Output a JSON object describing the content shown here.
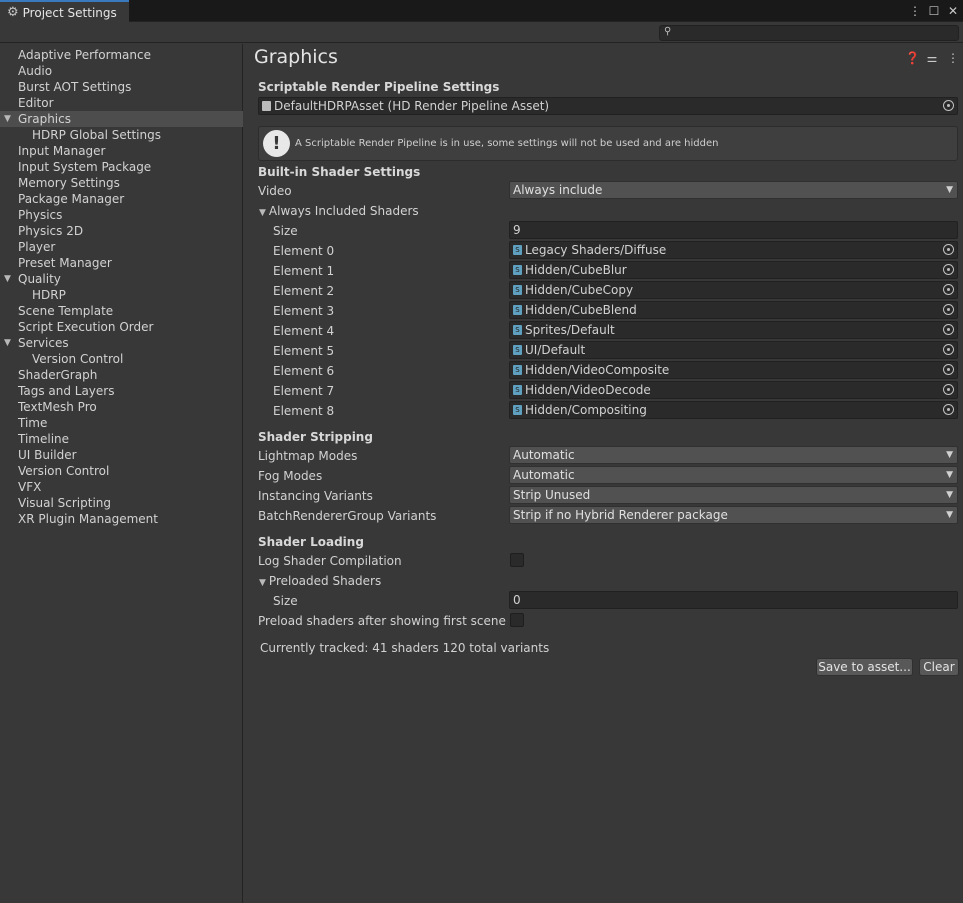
{
  "window": {
    "tab_title": "Project Settings"
  },
  "search": {
    "placeholder": ""
  },
  "sidebar": {
    "items": [
      {
        "label": "Adaptive Performance",
        "indent": 0
      },
      {
        "label": "Audio",
        "indent": 0
      },
      {
        "label": "Burst AOT Settings",
        "indent": 0
      },
      {
        "label": "Editor",
        "indent": 0
      },
      {
        "label": "Graphics",
        "indent": 0,
        "expanded": true,
        "selected": true
      },
      {
        "label": "HDRP Global Settings",
        "indent": 1
      },
      {
        "label": "Input Manager",
        "indent": 0
      },
      {
        "label": "Input System Package",
        "indent": 0
      },
      {
        "label": "Memory Settings",
        "indent": 0
      },
      {
        "label": "Package Manager",
        "indent": 0
      },
      {
        "label": "Physics",
        "indent": 0
      },
      {
        "label": "Physics 2D",
        "indent": 0
      },
      {
        "label": "Player",
        "indent": 0
      },
      {
        "label": "Preset Manager",
        "indent": 0
      },
      {
        "label": "Quality",
        "indent": 0,
        "expanded": true
      },
      {
        "label": "HDRP",
        "indent": 1
      },
      {
        "label": "Scene Template",
        "indent": 0
      },
      {
        "label": "Script Execution Order",
        "indent": 0
      },
      {
        "label": "Services",
        "indent": 0,
        "expanded": true
      },
      {
        "label": "Version Control",
        "indent": 1
      },
      {
        "label": "ShaderGraph",
        "indent": 0
      },
      {
        "label": "Tags and Layers",
        "indent": 0
      },
      {
        "label": "TextMesh Pro",
        "indent": 0
      },
      {
        "label": "Time",
        "indent": 0
      },
      {
        "label": "Timeline",
        "indent": 0
      },
      {
        "label": "UI Builder",
        "indent": 0
      },
      {
        "label": "Version Control",
        "indent": 0
      },
      {
        "label": "VFX",
        "indent": 0
      },
      {
        "label": "Visual Scripting",
        "indent": 0
      },
      {
        "label": "XR Plugin Management",
        "indent": 0
      }
    ]
  },
  "main": {
    "title": "Graphics",
    "srp": {
      "heading": "Scriptable Render Pipeline Settings",
      "asset": "DefaultHDRPAsset (HD Render Pipeline Asset)",
      "warning": "A Scriptable Render Pipeline is in use, some settings will not be used and are hidden"
    },
    "builtin": {
      "heading": "Built-in Shader Settings",
      "video_label": "Video",
      "video_value": "Always include",
      "always_included_label": "Always Included Shaders",
      "size_label": "Size",
      "size_value": "9",
      "elements": [
        {
          "label": "Element 0",
          "value": "Legacy Shaders/Diffuse"
        },
        {
          "label": "Element 1",
          "value": "Hidden/CubeBlur"
        },
        {
          "label": "Element 2",
          "value": "Hidden/CubeCopy"
        },
        {
          "label": "Element 3",
          "value": "Hidden/CubeBlend"
        },
        {
          "label": "Element 4",
          "value": "Sprites/Default"
        },
        {
          "label": "Element 5",
          "value": "UI/Default"
        },
        {
          "label": "Element 6",
          "value": "Hidden/VideoComposite"
        },
        {
          "label": "Element 7",
          "value": "Hidden/VideoDecode"
        },
        {
          "label": "Element 8",
          "value": "Hidden/Compositing"
        }
      ]
    },
    "stripping": {
      "heading": "Shader Stripping",
      "rows": [
        {
          "label": "Lightmap Modes",
          "value": "Automatic"
        },
        {
          "label": "Fog Modes",
          "value": "Automatic"
        },
        {
          "label": "Instancing Variants",
          "value": "Strip Unused"
        },
        {
          "label": "BatchRendererGroup Variants",
          "value": "Strip if no Hybrid Renderer package"
        }
      ]
    },
    "loading": {
      "heading": "Shader Loading",
      "log_label": "Log Shader Compilation",
      "log_checked": false,
      "preloaded_label": "Preloaded Shaders",
      "size_label": "Size",
      "size_value": "0",
      "preload_after_label": "Preload shaders after showing first scene",
      "preload_after_checked": false
    },
    "status": "Currently tracked: 41 shaders 120 total variants",
    "save_button": "Save to asset...",
    "clear_button": "Clear"
  }
}
